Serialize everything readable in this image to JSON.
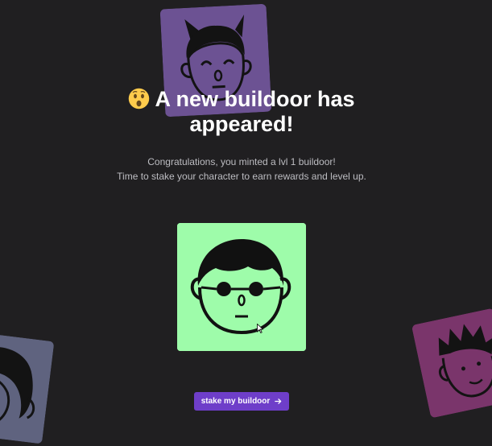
{
  "hero": {
    "emoji_icon": "surprised-face-emoji",
    "headline": "A new buildoor has appeared!",
    "subtitle_line1": "Congratulations, you minted a lvl 1 buildoor!",
    "subtitle_line2": "Time to stake your character to earn rewards and level up."
  },
  "minted_card": {
    "background": "#9efcaa",
    "character": "buildoor-face-with-round-glasses"
  },
  "decor_cards": [
    {
      "color": "#7a5ba8",
      "character": "buildoor-face-with-horns"
    },
    {
      "color": "#6b7090",
      "character": "buildoor-face-with-bob-hair"
    },
    {
      "color": "#8a3a78",
      "character": "buildoor-face-with-spiky-hair"
    }
  ],
  "actions": {
    "stake_label": "stake my buildoor",
    "stake_icon": "arrow-right-icon",
    "stake_color": "#6e3ec9"
  }
}
